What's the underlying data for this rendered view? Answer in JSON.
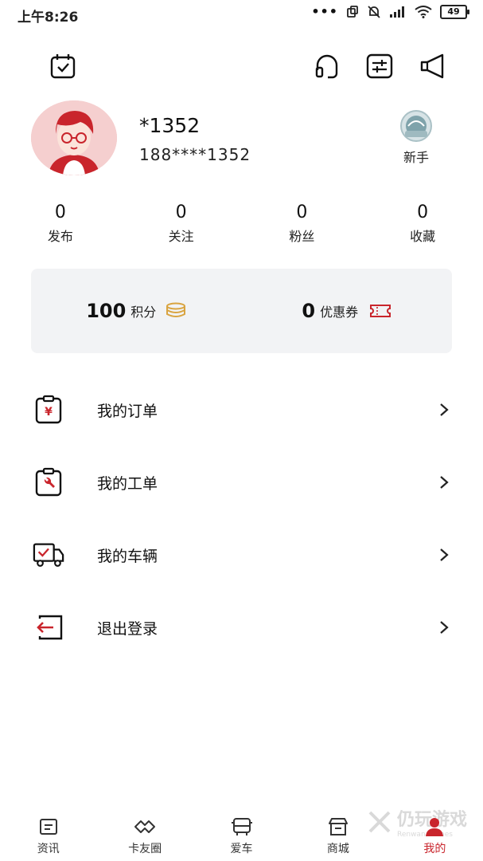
{
  "status_bar": {
    "time": "上午8:26",
    "battery": "49"
  },
  "header": {
    "icons": [
      "calendar-check-icon",
      "headset-icon",
      "settings-sliders-icon",
      "speaker-icon"
    ]
  },
  "profile": {
    "nickname": "*1352",
    "phone": "188****1352",
    "level": "新手"
  },
  "stats": [
    {
      "value": "0",
      "label": "发布"
    },
    {
      "value": "0",
      "label": "关注"
    },
    {
      "value": "0",
      "label": "粉丝"
    },
    {
      "value": "0",
      "label": "收藏"
    }
  ],
  "wallet": {
    "points_value": "100",
    "points_label": "积分",
    "coupon_value": "0",
    "coupon_label": "优惠券"
  },
  "menu": [
    {
      "label": "我的订单",
      "icon": "order-clipboard-icon"
    },
    {
      "label": "我的工单",
      "icon": "work-order-wrench-icon"
    },
    {
      "label": "我的车辆",
      "icon": "truck-check-icon"
    },
    {
      "label": "退出登录",
      "icon": "logout-icon"
    }
  ],
  "tabs": [
    {
      "label": "资讯",
      "icon": "news-icon"
    },
    {
      "label": "卡友圈",
      "icon": "handshake-icon"
    },
    {
      "label": "爱车",
      "icon": "bus-icon"
    },
    {
      "label": "商城",
      "icon": "shop-icon"
    },
    {
      "label": "我的",
      "icon": "user-icon"
    }
  ],
  "active_tab": "我的",
  "watermark": {
    "title": "仍玩游戏",
    "subtitle": "Renwan Games"
  },
  "colors": {
    "accent": "#c9252c",
    "card_bg": "#f2f3f5",
    "coin": "#d9a441"
  }
}
